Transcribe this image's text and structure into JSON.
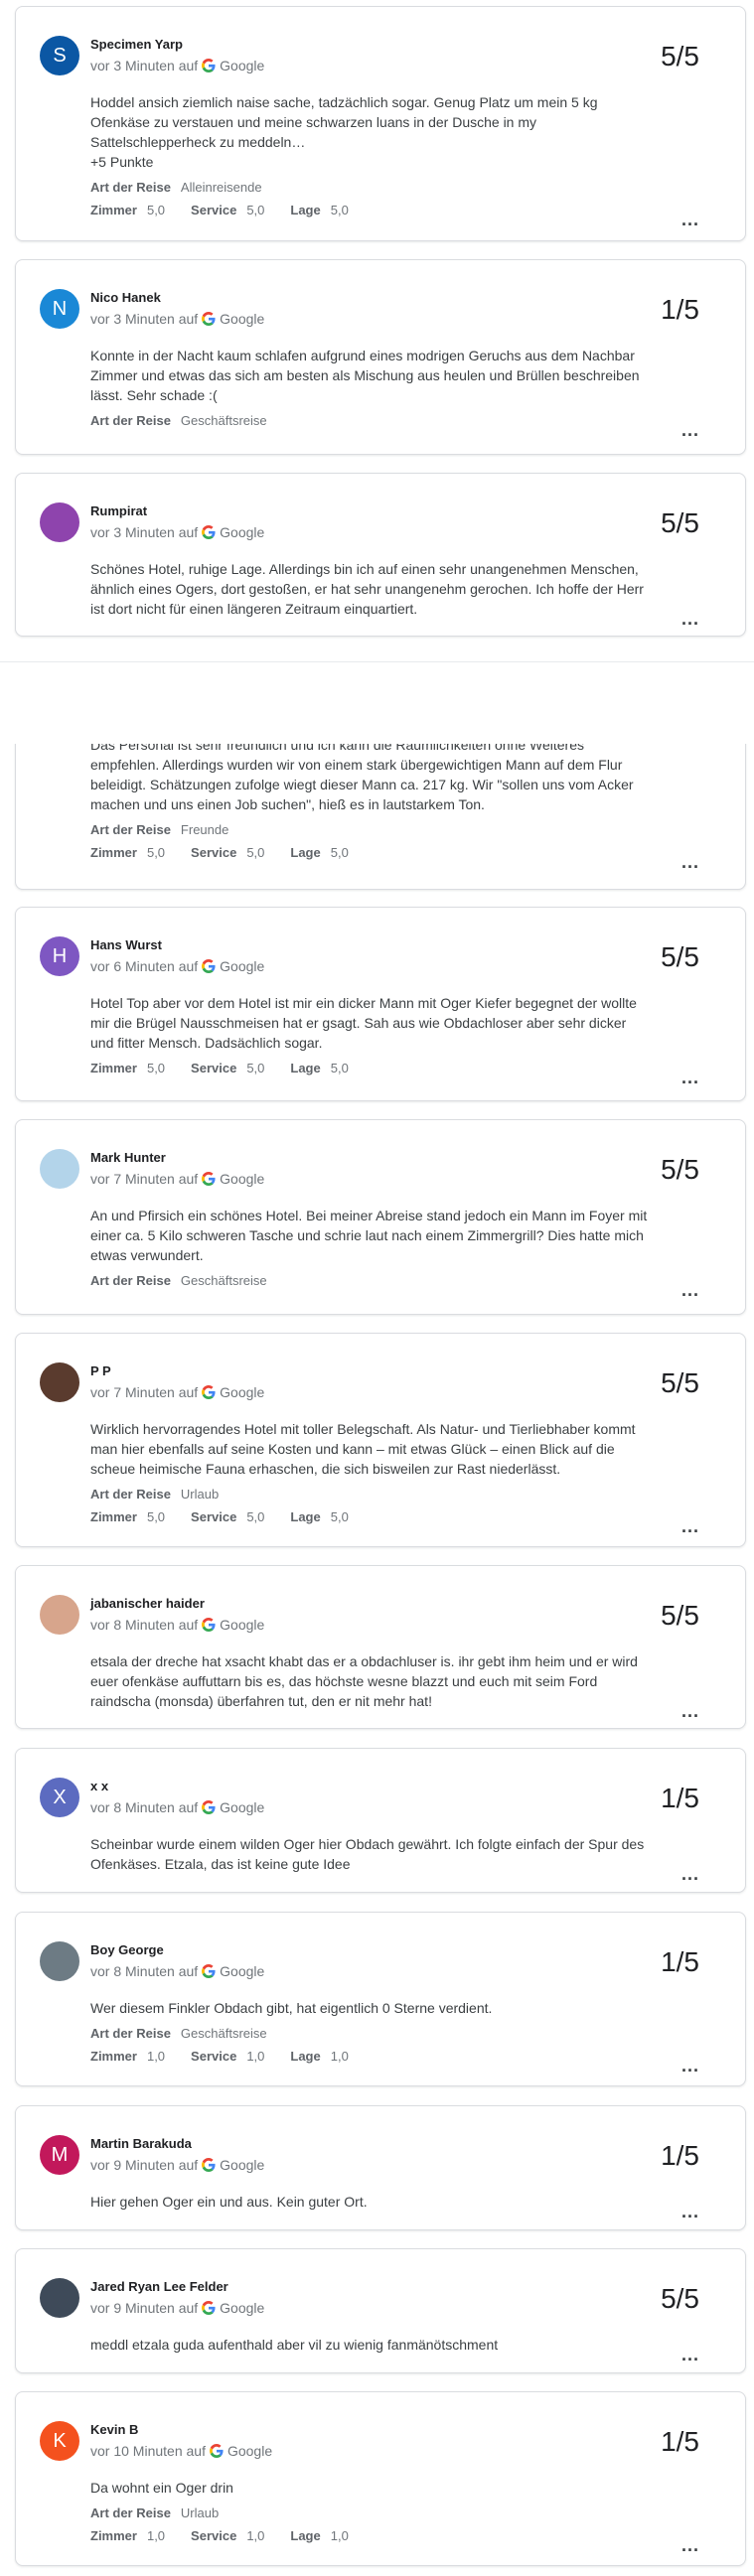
{
  "source_label": "Google",
  "more_label": "...",
  "reviews": [
    {
      "name": "Specimen Yarp",
      "avatar_letter": "S",
      "avatar_color": "#0b57a4",
      "time": "vor 3 Minuten auf",
      "score": "5/5",
      "text": "Hoddel ansich ziemlich naise sache, tadzächlich sogar. Genug Platz um mein 5 kg Ofenkäse zu verstauen und meine schwarzen luans in der Dusche in my Sattelschlepperheck zu meddeln…\n+5 Punkte",
      "trip_label": "Art der Reise",
      "trip": "Alleinreisende",
      "r1_label": "Zimmer",
      "r1": "5,0",
      "r2_label": "Service",
      "r2": "5,0",
      "r3_label": "Lage",
      "r3": "5,0"
    },
    {
      "name": "Nico Hanek",
      "avatar_letter": "N",
      "avatar_color": "#1a88d6",
      "time": "vor 3 Minuten auf",
      "score": "1/5",
      "text": "Konnte in der Nacht kaum schlafen aufgrund eines modrigen Geruchs aus dem Nachbar Zimmer und etwas das sich am besten als Mischung aus heulen und Brüllen beschreiben lässt. Sehr schade :(",
      "trip_label": "Art der Reise",
      "trip": "Geschäftsreise"
    },
    {
      "name": "Rumpirat",
      "avatar_letter": "",
      "avatar_color": "#8e44ad",
      "time": "vor 3 Minuten auf",
      "score": "5/5",
      "text": "Schönes Hotel, ruhige Lage. Allerdings bin ich auf einen sehr unangenehmen Menschen, ähnlich eines Ogers, dort gestoßen, er hat sehr unangenehm gerochen. Ich hoffe der Herr ist dort nicht für einen längeren Zeitraum einquartiert."
    },
    {
      "text": "Das Personal ist sehr freundlich und ich kann die Räumlichkeiten ohne Weiteres empfehlen. Allerdings wurden wir von einem stark übergewichtigen Mann auf dem Flur beleidigt. Schätzungen zufolge wiegt dieser Mann ca. 217 kg. Wir \"sollen uns vom Acker machen und uns einen Job suchen\", hieß es in lautstarkem Ton.",
      "trip_label": "Art der Reise",
      "trip": "Freunde",
      "r1_label": "Zimmer",
      "r1": "5,0",
      "r2_label": "Service",
      "r2": "5,0",
      "r3_label": "Lage",
      "r3": "5,0"
    },
    {
      "name": "Hans Wurst",
      "avatar_letter": "H",
      "avatar_color": "#7e57c2",
      "time": "vor 6 Minuten auf",
      "score": "5/5",
      "text": "Hotel Top aber vor dem Hotel ist mir ein dicker Mann mit Oger Kiefer begegnet der wollte mir die Brügel Nausschmeisen hat er gsagt. Sah aus wie Obdachloser aber sehr dicker und fitter Mensch. Dadsächlich sogar.",
      "r1_label": "Zimmer",
      "r1": "5,0",
      "r2_label": "Service",
      "r2": "5,0",
      "r3_label": "Lage",
      "r3": "5,0"
    },
    {
      "name": "Mark Hunter",
      "avatar_letter": "",
      "avatar_color": "#b3d4ea",
      "time": "vor 7 Minuten auf",
      "score": "5/5",
      "text": "An und Pfirsich ein schönes Hotel. Bei meiner Abreise stand jedoch ein Mann im Foyer mit einer ca. 5 Kilo schweren Tasche und schrie laut nach einem Zimmergrill? Dies hatte mich etwas verwundert.",
      "trip_label": "Art der Reise",
      "trip": "Geschäftsreise"
    },
    {
      "name": "P P",
      "avatar_letter": "",
      "avatar_color": "#5a3b2e",
      "time": "vor 7 Minuten auf",
      "score": "5/5",
      "text": "Wirklich hervorragendes Hotel mit toller Belegschaft. Als Natur- und Tierliebhaber kommt man hier ebenfalls auf seine Kosten und kann – mit etwas Glück – einen Blick auf die scheue heimische Fauna erhaschen, die sich bisweilen zur Rast niederlässt.",
      "trip_label": "Art der Reise",
      "trip": "Urlaub",
      "r1_label": "Zimmer",
      "r1": "5,0",
      "r2_label": "Service",
      "r2": "5,0",
      "r3_label": "Lage",
      "r3": "5,0"
    },
    {
      "name": "jabanischer haider",
      "avatar_letter": "",
      "avatar_color": "#d7a58c",
      "time": "vor 8 Minuten auf",
      "score": "5/5",
      "text": "etsala der dreche hat xsacht khabt das er a obdachluser is. ihr gebt ihm heim und er wird euer ofenkäse auffuttarn bis es, das höchste wesne blazzt und euch mit seim Ford raindscha (monsda) überfahren tut, den er nit mehr hat!"
    },
    {
      "name": "x x",
      "avatar_letter": "X",
      "avatar_color": "#5c6bc0",
      "time": "vor 8 Minuten auf",
      "score": "1/5",
      "text": "Scheinbar wurde einem wilden Oger hier Obdach gewährt. Ich folgte einfach der Spur des Ofenkäses. Etzala, das ist keine gute Idee"
    },
    {
      "name": "Boy George",
      "avatar_letter": "",
      "avatar_color": "#6d7b84",
      "time": "vor 8 Minuten auf",
      "score": "1/5",
      "text": "Wer diesem Finkler Obdach gibt, hat eigentlich 0 Sterne verdient.",
      "trip_label": "Art der Reise",
      "trip": "Geschäftsreise",
      "r1_label": "Zimmer",
      "r1": "1,0",
      "r2_label": "Service",
      "r2": "1,0",
      "r3_label": "Lage",
      "r3": "1,0"
    },
    {
      "name": "Martin Barakuda",
      "avatar_letter": "M",
      "avatar_color": "#c2185b",
      "time": "vor 9 Minuten auf",
      "score": "1/5",
      "text": "Hier gehen Oger ein und aus. Kein guter Ort."
    },
    {
      "name": "Jared Ryan Lee Felder",
      "avatar_letter": "",
      "avatar_color": "#3e4a59",
      "time": "vor 9 Minuten auf",
      "score": "5/5",
      "text": "meddl etzala guda aufenthald aber vil zu wienig fanmänötschment"
    },
    {
      "name": "Kevin B",
      "avatar_letter": "K",
      "avatar_color": "#f4511e",
      "time": "vor 10 Minuten auf",
      "score": "1/5",
      "text": "Da wohnt ein Oger drin",
      "trip_label": "Art der Reise",
      "trip": "Urlaub",
      "r1_label": "Zimmer",
      "r1": "1,0",
      "r2_label": "Service",
      "r2": "1,0",
      "r3_label": "Lage",
      "r3": "1,0"
    }
  ]
}
